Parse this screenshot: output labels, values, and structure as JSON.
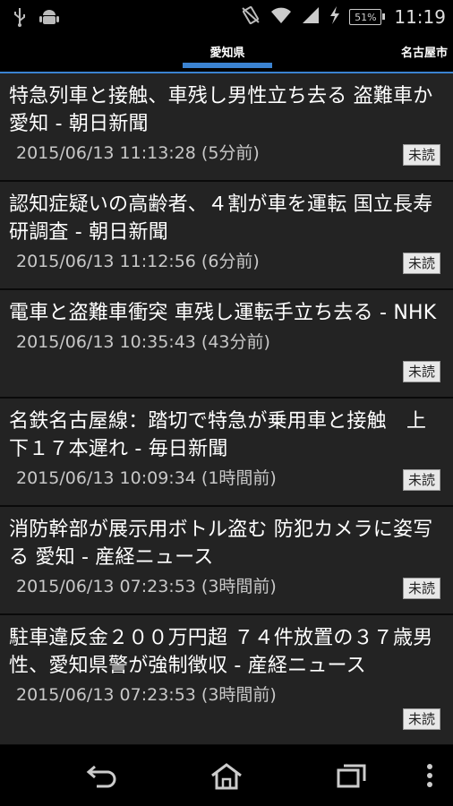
{
  "status_bar": {
    "time": "11:19",
    "battery": "51%",
    "icons": [
      "usb-icon",
      "android-icon",
      "vibrate-icon",
      "wifi-icon",
      "signal-icon",
      "charging-icon",
      "battery-icon"
    ]
  },
  "tabs": {
    "active": "愛知県",
    "next": "名古屋市"
  },
  "news": [
    {
      "title": "特急列車と接触、車残し男性立ち去る 盗難車か 愛知 - 朝日新聞",
      "meta": "2015/06/13 11:13:28 (5分前)",
      "badge": "未読"
    },
    {
      "title": "認知症疑いの高齢者、４割が車を運転 国立長寿研調査 - 朝日新聞",
      "meta": "2015/06/13 11:12:56 (6分前)",
      "badge": "未読"
    },
    {
      "title": "電車と盗難車衝突 車残し運転手立ち去る - NHK",
      "meta": "2015/06/13 10:35:43 (43分前)",
      "badge": "未読"
    },
    {
      "title": "名鉄名古屋線：踏切で特急が乗用車と接触　上下１７本遅れ - 毎日新聞",
      "meta": "2015/06/13 10:09:34 (1時間前)",
      "badge": "未読"
    },
    {
      "title": "消防幹部が展示用ボトル盗む 防犯カメラに姿写る 愛知 - 産経ニュース",
      "meta": "2015/06/13 07:23:53 (3時間前)",
      "badge": "未読"
    },
    {
      "title": "駐車違反金２００万円超 ７４件放置の３７歳男性、愛知県警が強制徴収 - 産経ニュース",
      "meta": "2015/06/13 07:23:53 (3時間前)",
      "badge": "未読"
    }
  ],
  "colors": {
    "accent": "#3b83d1",
    "item_bg": "#232323"
  }
}
